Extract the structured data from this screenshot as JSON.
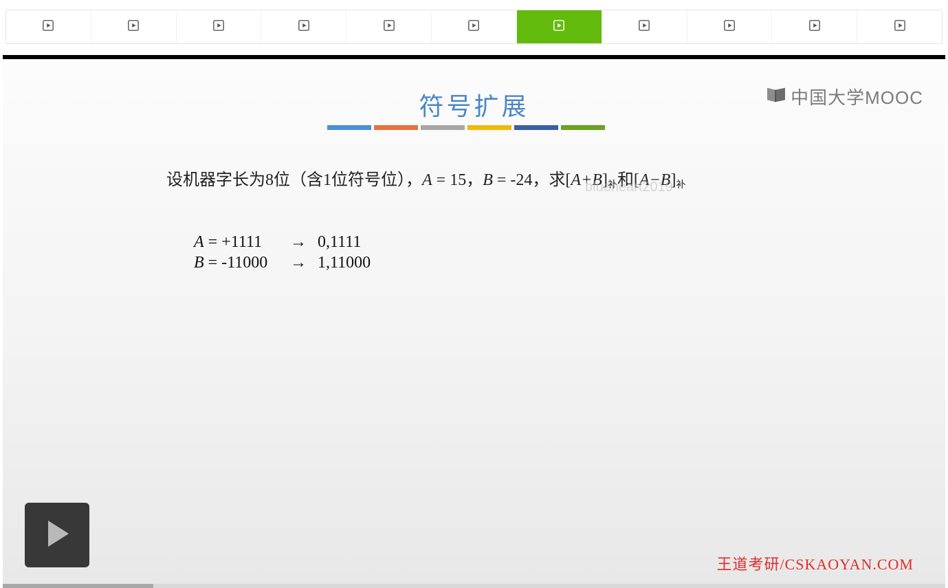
{
  "tabs": {
    "count": 11,
    "active_index": 6
  },
  "slide": {
    "title": "符号扩展",
    "bars": [
      "#4a90d9",
      "#e8713d",
      "#a6a6a6",
      "#f2b90c",
      "#3a5fa8",
      "#6aa31f"
    ],
    "problem_prefix": "设机器字长为8位（含1位符号位），",
    "problem_A_label": "A",
    "problem_A_value": " = 15，",
    "problem_B_label": "B",
    "problem_B_value": " = -24，",
    "problem_suffix1": "求[",
    "problem_expr1_it": "A+B",
    "problem_suffix2": "]",
    "sub_bu": "补",
    "problem_and": "和[",
    "problem_expr2_it": "A−B",
    "problem_suffix3": "]",
    "rows": [
      {
        "lhs_var": "A",
        "lhs_rest": " = +1111",
        "arrow": "→",
        "rhs": "0,1111"
      },
      {
        "lhs_var": "B",
        "lhs_rest": " = -11000",
        "arrow": "→",
        "rhs": "1,11000"
      }
    ],
    "watermark": "blueheart2019",
    "brand_mooc": "中国大学MOOC",
    "brand_footer": "王道考研/CSKAOYAN.COM"
  },
  "player": {
    "progress_played_percent": 14,
    "progress_buffered_percent": 16
  }
}
